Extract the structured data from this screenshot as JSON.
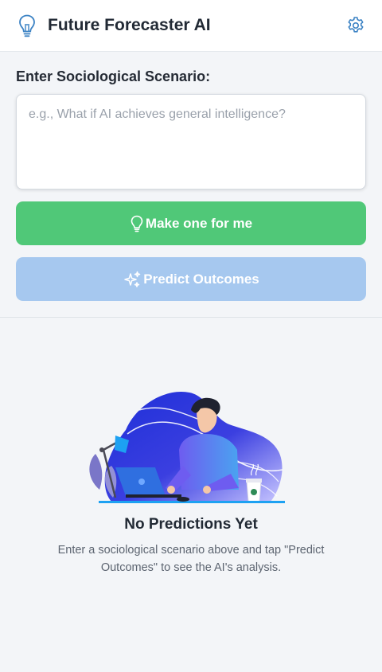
{
  "header": {
    "title": "Future Forecaster AI",
    "logo_icon": "lightbulb-icon",
    "settings_icon": "gear-icon"
  },
  "form": {
    "label": "Enter Sociological Scenario:",
    "input_placeholder": "e.g., What if AI achieves general intelligence?",
    "input_value": ""
  },
  "buttons": {
    "make_one": {
      "label": "Make one for me",
      "icon": "lightbulb-icon",
      "color": "#50c878"
    },
    "predict": {
      "label": "Predict Outcomes",
      "icon": "sparkles-icon",
      "color": "#a6c8ef",
      "state": "disabled"
    }
  },
  "empty_state": {
    "title": "No Predictions Yet",
    "description": "Enter a sociological scenario above and tap \"Predict Outcomes\" to see the AI's analysis."
  },
  "colors": {
    "accent_blue": "#3b82c4",
    "background": "#f3f5f8"
  }
}
